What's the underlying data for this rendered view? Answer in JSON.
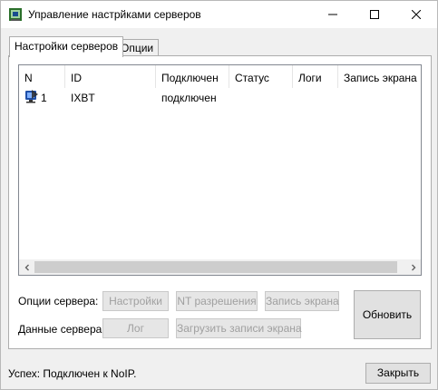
{
  "window": {
    "title": "Управление настрйками серверов",
    "icon": "server-app-icon"
  },
  "tabs": [
    {
      "label": "Настройки серверов",
      "active": true
    },
    {
      "label": "Опции",
      "active": false
    }
  ],
  "servers_list": {
    "columns": [
      "N",
      "ID",
      "Подключен",
      "Статус",
      "Логи",
      "Запись экрана"
    ],
    "rows": [
      {
        "n": "1",
        "id": "IXBT",
        "connected": "подключен",
        "status": "",
        "logs": "",
        "screen_record": ""
      }
    ]
  },
  "server_options": {
    "label": "Опции сервера:",
    "settings_button": "Настройки",
    "nt_permissions_button": "NT разрешения",
    "screen_record_button": "Запись экрана"
  },
  "server_data": {
    "label": "Данные сервера:",
    "log_button": "Лог",
    "load_records_button": "Загрузить записи экрана"
  },
  "refresh_button": "Обновить",
  "status_text": "Успех: Подключен к NoIP.",
  "close_button": "Закрыть",
  "colors": {
    "window_bg": "#f0f0f0",
    "panel_bg": "#ffffff",
    "disabled_text": "#a0a0a0"
  }
}
